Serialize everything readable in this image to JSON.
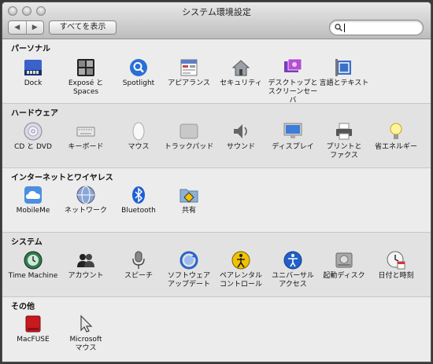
{
  "window": {
    "title": "システム環境設定",
    "nav": {
      "back": "◀",
      "forward": "▶"
    },
    "show_all": "すべてを表示",
    "search": {
      "value": "",
      "placeholder": ""
    }
  },
  "sections": [
    {
      "title": "パーソナル",
      "items": [
        {
          "label": "Dock",
          "icon": "dock-icon"
        },
        {
          "label": "Exposé と\nSpaces",
          "icon": "expose-icon"
        },
        {
          "label": "Spotlight",
          "icon": "spotlight-icon"
        },
        {
          "label": "アピアランス",
          "icon": "appearance-icon"
        },
        {
          "label": "セキュリティ",
          "icon": "security-icon"
        },
        {
          "label": "デスクトップと\nスクリーンセーバ",
          "icon": "desktop-icon"
        },
        {
          "label": "言語とテキスト",
          "icon": "language-icon"
        }
      ]
    },
    {
      "title": "ハードウェア",
      "items": [
        {
          "label": "CD と DVD",
          "icon": "cd-dvd-icon"
        },
        {
          "label": "キーボード",
          "icon": "keyboard-icon"
        },
        {
          "label": "マウス",
          "icon": "mouse-icon"
        },
        {
          "label": "トラックパッド",
          "icon": "trackpad-icon"
        },
        {
          "label": "サウンド",
          "icon": "sound-icon"
        },
        {
          "label": "ディスプレイ",
          "icon": "display-icon"
        },
        {
          "label": "プリントと\nファクス",
          "icon": "printer-icon"
        },
        {
          "label": "省エネルギー",
          "icon": "energy-saver-icon"
        }
      ]
    },
    {
      "title": "インターネットとワイヤレス",
      "items": [
        {
          "label": "MobileMe",
          "icon": "mobileme-icon"
        },
        {
          "label": "ネットワーク",
          "icon": "network-icon"
        },
        {
          "label": "Bluetooth",
          "icon": "bluetooth-icon"
        },
        {
          "label": "共有",
          "icon": "sharing-icon"
        }
      ]
    },
    {
      "title": "システム",
      "items": [
        {
          "label": "Time Machine",
          "icon": "time-machine-icon"
        },
        {
          "label": "アカウント",
          "icon": "accounts-icon"
        },
        {
          "label": "スピーチ",
          "icon": "speech-icon"
        },
        {
          "label": "ソフトウェア\nアップデート",
          "icon": "software-update-icon"
        },
        {
          "label": "ペアレンタル\nコントロール",
          "icon": "parental-controls-icon"
        },
        {
          "label": "ユニバーサル\nアクセス",
          "icon": "universal-access-icon"
        },
        {
          "label": "起動ディスク",
          "icon": "startup-disk-icon"
        },
        {
          "label": "日付と時刻",
          "icon": "date-time-icon"
        }
      ]
    },
    {
      "title": "その他",
      "items": [
        {
          "label": "MacFUSE",
          "icon": "macfuse-icon"
        },
        {
          "label": "Microsoft\nマウス",
          "icon": "microsoft-mouse-icon"
        }
      ]
    }
  ]
}
